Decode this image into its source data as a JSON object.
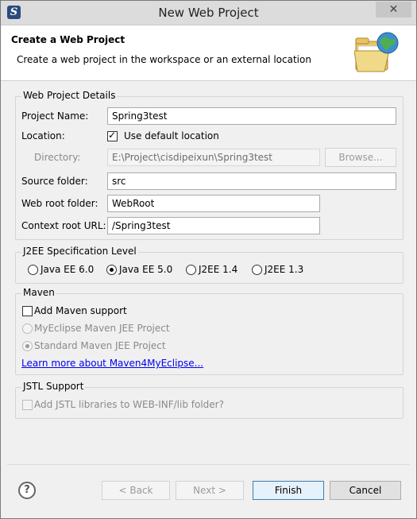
{
  "window": {
    "title": "New Web Project",
    "close_symbol": "✕"
  },
  "header": {
    "title": "Create a Web Project",
    "description": "Create a web project in the workspace or an external location",
    "icon": "folder-globe-icon"
  },
  "details": {
    "group_title": "Web Project Details",
    "project_name": {
      "label": "Project Name:",
      "value": "Spring3test"
    },
    "location": {
      "label": "Location:",
      "checkbox_label": "Use default location",
      "checked": true
    },
    "directory": {
      "label": "Directory:",
      "value": "E:\\Project\\cisdipeixun\\Spring3test",
      "browse_label": "Browse..."
    },
    "source_folder": {
      "label": "Source folder:",
      "value": "src"
    },
    "web_root_folder": {
      "label": "Web root folder:",
      "value": "WebRoot"
    },
    "context_root_url": {
      "label": "Context root URL:",
      "value": "/Spring3test"
    }
  },
  "j2ee": {
    "group_title": "J2EE Specification Level",
    "options": [
      "Java EE 6.0",
      "Java EE 5.0",
      "J2EE 1.4",
      "J2EE 1.3"
    ],
    "selected": "Java EE 5.0"
  },
  "maven": {
    "group_title": "Maven",
    "add_support_label": "Add Maven support",
    "add_support_checked": false,
    "options": [
      "MyEclipse Maven JEE Project",
      "Standard Maven JEE Project"
    ],
    "selected": "Standard Maven JEE Project",
    "learn_more_link": "Learn more about Maven4MyEclipse..."
  },
  "jstl": {
    "group_title": "JSTL Support",
    "checkbox_label": "Add JSTL libraries to WEB-INF/lib folder?",
    "checked": false
  },
  "footer": {
    "help_symbol": "?",
    "back_label": "< Back",
    "next_label": "Next >",
    "finish_label": "Finish",
    "cancel_label": "Cancel"
  }
}
